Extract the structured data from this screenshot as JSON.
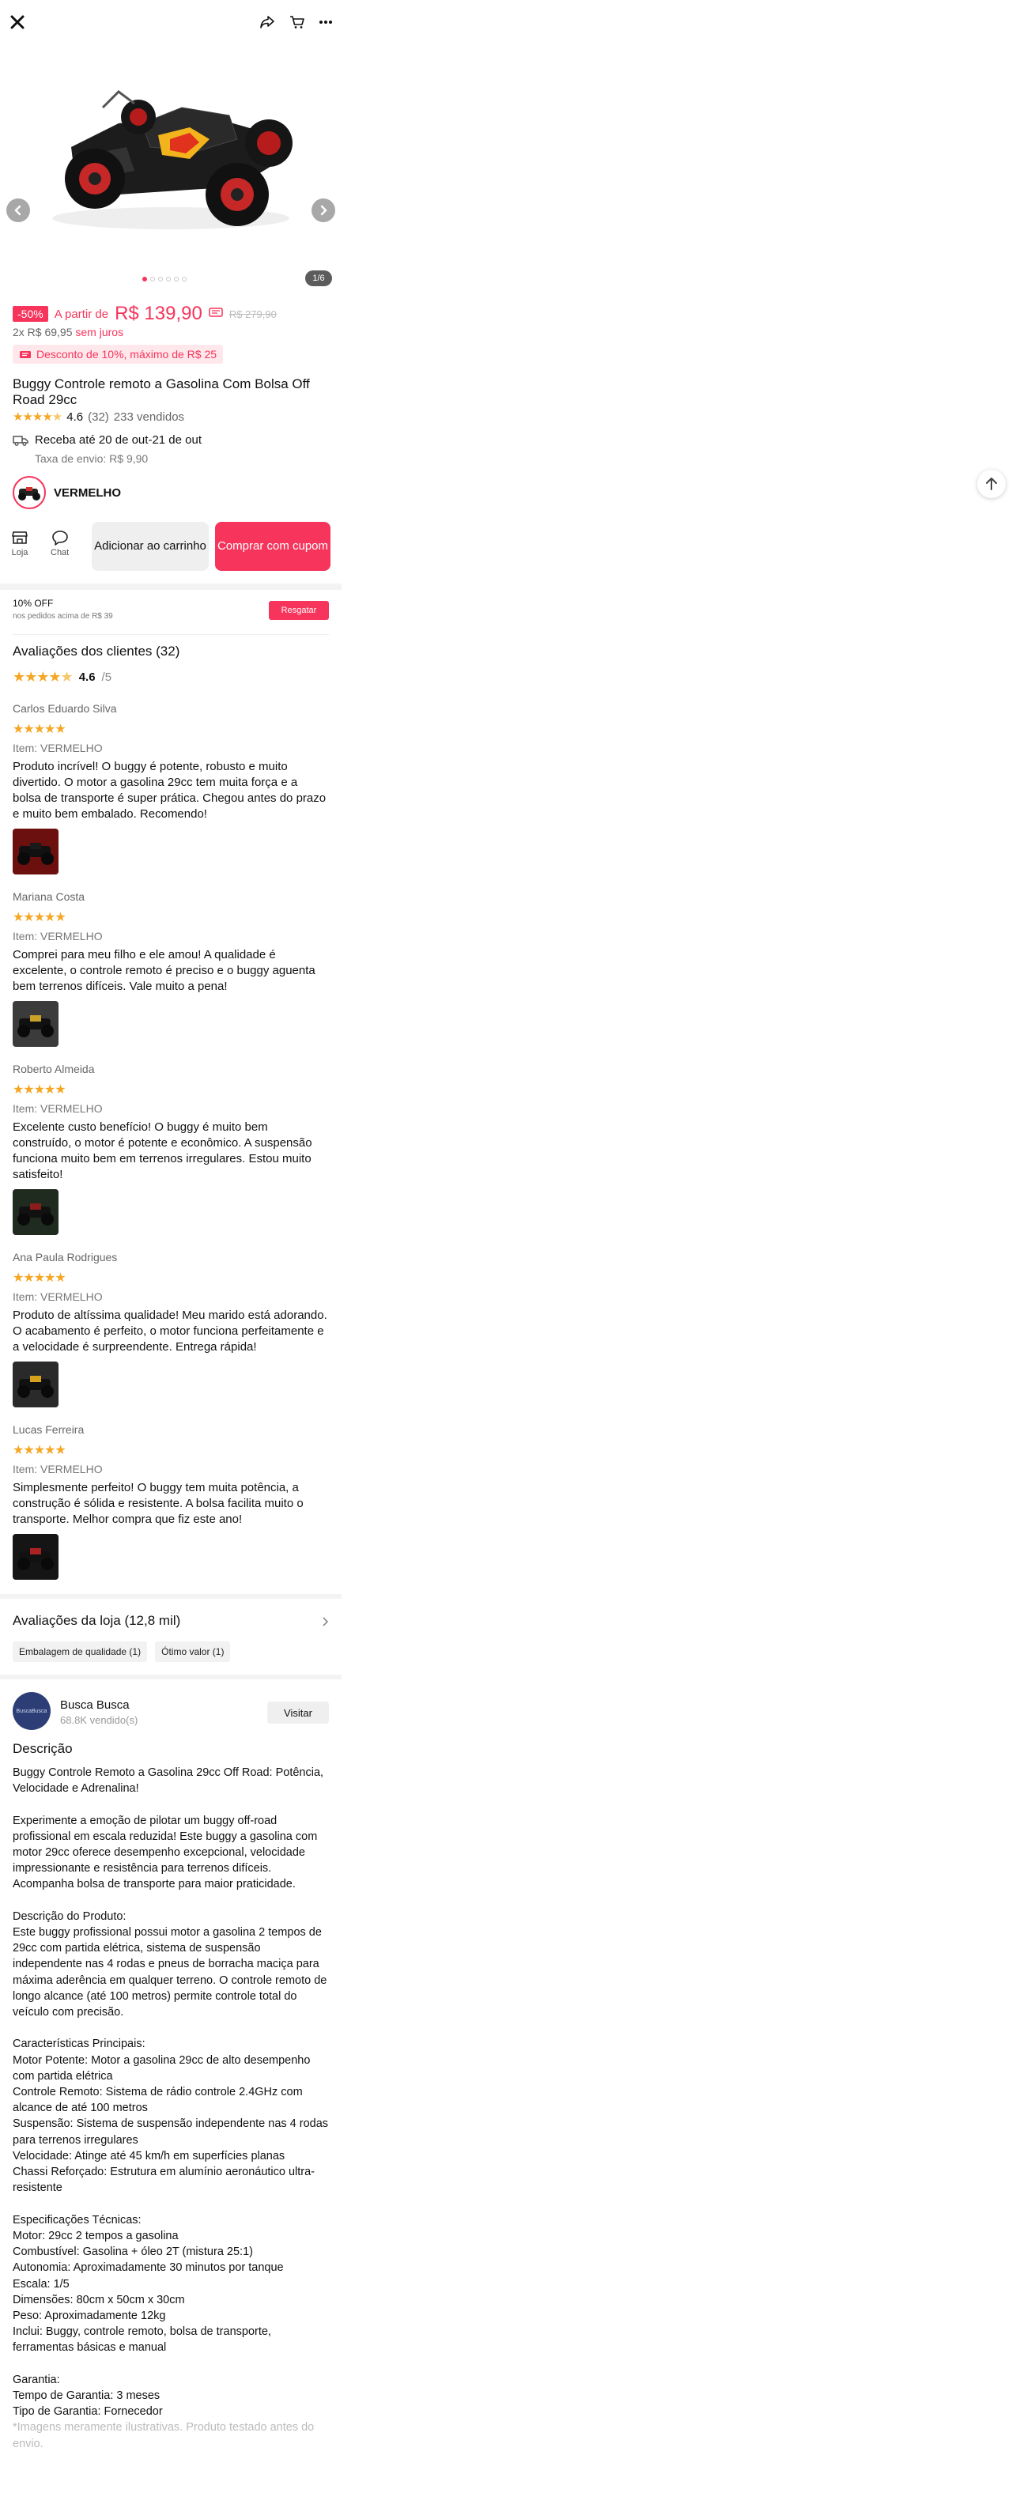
{
  "product": {
    "discount_badge": "-50%",
    "from_label": "A partir de",
    "price": "R$ 139,90",
    "old_price": "R$ 279,90",
    "installments_prefix": "2x R$ 69,95",
    "installments_suffix": "sem juros",
    "coupon_text": "Desconto de 10%, máximo de R$ 25",
    "title": "Buggy Controle remoto a Gasolina Com Bolsa Off Road 29cc",
    "rating": "4.6",
    "rating_count": "(32)",
    "sold": "233 vendidos",
    "delivery": "Receba até 20 de out-21 de out",
    "shipping_fee": "Taxa de envio: R$ 9,90",
    "variant": "VERMELHO",
    "gallery_counter": "1/6",
    "gallery_total": 6,
    "gallery_active": 0
  },
  "actions": {
    "store_label": "Loja",
    "chat_label": "Chat",
    "cart_label": "Adicionar ao carrinho",
    "buy_label": "Comprar com cupom"
  },
  "promo": {
    "title": "10% OFF",
    "subtitle": "nos pedidos acima de R$ 39",
    "button": "Resgatar"
  },
  "reviews": {
    "title": "Avaliações dos clientes (32)",
    "average": "4.6",
    "out_of": "/5",
    "list": [
      {
        "name": "Carlos Eduardo Silva",
        "item": "Item: VERMELHO",
        "text": "Produto incrível! O buggy é potente, robusto e muito divertido. O motor a gasolina 29cc tem muita força e a bolsa de transporte é super prática. Chegou antes do prazo e muito bem embalado. Recomendo!"
      },
      {
        "name": "Mariana Costa",
        "item": "Item: VERMELHO",
        "text": "Comprei para meu filho e ele amou! A qualidade é excelente, o controle remoto é preciso e o buggy aguenta bem terrenos difíceis. Vale muito a pena!"
      },
      {
        "name": "Roberto Almeida",
        "item": "Item: VERMELHO",
        "text": "Excelente custo benefício! O buggy é muito bem construído, o motor é potente e econômico. A suspensão funciona muito bem em terrenos irregulares. Estou muito satisfeito!"
      },
      {
        "name": "Ana Paula Rodrigues",
        "item": "Item: VERMELHO",
        "text": "Produto de altíssima qualidade! Meu marido está adorando. O acabamento é perfeito, o motor funciona perfeitamente e a velocidade é surpreendente. Entrega rápida!"
      },
      {
        "name": "Lucas Ferreira",
        "item": "Item: VERMELHO",
        "text": "Simplesmente perfeito! O buggy tem muita potência, a construção é sólida e resistente. A bolsa facilita muito o transporte. Melhor compra que fiz este ano!"
      }
    ]
  },
  "store_reviews": {
    "title": "Avaliações da loja (12,8 mil)",
    "tags": [
      "Embalagem de qualidade (1)",
      "Ótimo valor (1)"
    ]
  },
  "shop": {
    "logo_text": "BuscaBusca",
    "name": "Busca Busca",
    "sold": "68.8K vendido(s)",
    "visit": "Visitar"
  },
  "description": {
    "title": "Descrição",
    "body": "Buggy Controle Remoto a Gasolina 29cc Off Road: Potência, Velocidade e Adrenalina!\n\nExperimente a emoção de pilotar um buggy off-road profissional em escala reduzida! Este buggy a gasolina com motor 29cc oferece desempenho excepcional, velocidade impressionante e resistência para terrenos difíceis. Acompanha bolsa de transporte para maior praticidade.\n\nDescrição do Produto:\nEste buggy profissional possui motor a gasolina 2 tempos de 29cc com partida elétrica, sistema de suspensão independente nas 4 rodas e pneus de borracha maciça para máxima aderência em qualquer terreno. O controle remoto de longo alcance (até 100 metros) permite controle total do veículo com precisão.\n\nCaracterísticas Principais:\nMotor Potente: Motor a gasolina 29cc de alto desempenho com partida elétrica\nControle Remoto: Sistema de rádio controle 2.4GHz com alcance de até 100 metros\nSuspensão: Sistema de suspensão independente nas 4 rodas para terrenos irregulares\nVelocidade: Atinge até 45 km/h em superfícies planas\nChassi Reforçado: Estrutura em alumínio aeronáutico ultra-resistente\n\nEspecificações Técnicas:\nMotor: 29cc 2 tempos a gasolina\nCombustível: Gasolina + óleo 2T (mistura 25:1)\nAutonomia: Aproximadamente 30 minutos por tanque\nEscala: 1/5\nDimensões: 80cm x 50cm x 30cm\nPeso: Aproximadamente 12kg\nInclui: Buggy, controle remoto, bolsa de transporte, ferramentas básicas e manual\n\nGarantia:\nTempo de Garantia: 3 meses\nTipo de Garantia: Fornecedor",
    "note": "*Imagens meramente ilustrativas. Produto testado antes do envio."
  },
  "colors": {
    "accent": "#f7345b",
    "star": "#f5a623"
  }
}
